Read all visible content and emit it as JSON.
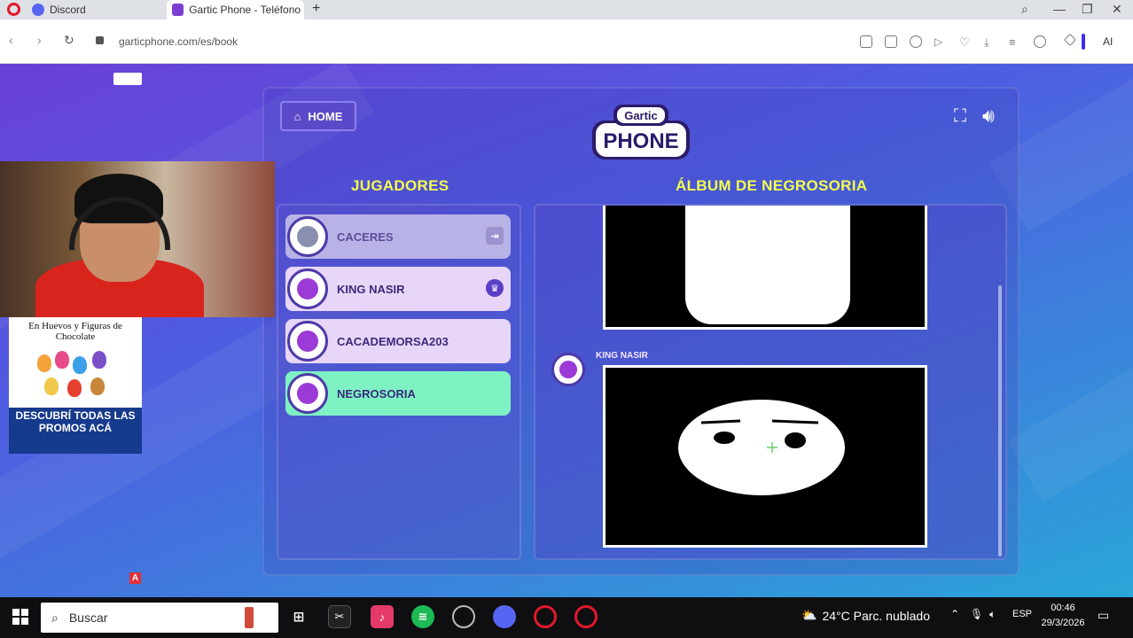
{
  "browser": {
    "tabs": [
      {
        "label": "Discord"
      },
      {
        "label": "Gartic Phone - Teléfono D"
      }
    ],
    "url": "garticphone.com/es/book",
    "ai_label": "AI"
  },
  "game": {
    "home_label": "HOME",
    "logo_top": "Gartic",
    "logo_bottom": "PHONE",
    "players_heading": "JUGADORES",
    "album_heading": "ÁLBUM DE NEGROSORIA",
    "players": [
      {
        "name": "CACERES",
        "state": "inactive",
        "badge": "exit"
      },
      {
        "name": "KING NASIR",
        "state": "normal",
        "badge": "crown"
      },
      {
        "name": "CACADEMORSA203",
        "state": "normal",
        "badge": ""
      },
      {
        "name": "NEGROSORIA",
        "state": "active",
        "badge": ""
      }
    ],
    "album_author": "KING NASIR"
  },
  "ad": {
    "title": "En Huevos y Figuras de Chocolate",
    "cta": "DESCUBRÍ TODAS LAS PROMOS ACÁ"
  },
  "overlay": {
    "a_badge": "A"
  },
  "taskbar": {
    "search_placeholder": "Buscar",
    "weather": "24°C  Parc. nublado",
    "language": "ESP",
    "time": "00:46",
    "date": "29/3/2026"
  },
  "colors": {
    "accent_heading": "#f4ff4a",
    "active_player": "#7ff2c4",
    "player_card": "#e7d6f7"
  }
}
